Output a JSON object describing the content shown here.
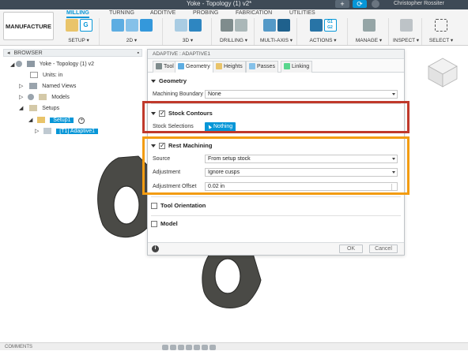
{
  "window": {
    "title": "Yoke - Topology (1) v2*",
    "user": "Christopher Rossiter"
  },
  "ribbon": {
    "workspace": "MANUFACTURE ▾",
    "tabs": [
      {
        "label": "MILLING",
        "active": true
      },
      {
        "label": "TURNING",
        "active": false
      },
      {
        "label": "ADDITIVE",
        "active": false
      },
      {
        "label": "PROBING",
        "active": false
      },
      {
        "label": "FABRICATION",
        "active": false
      },
      {
        "label": "UTILITIES",
        "active": false
      }
    ],
    "groups": [
      {
        "label": "SETUP ▾"
      },
      {
        "label": "2D ▾"
      },
      {
        "label": "3D ▾"
      },
      {
        "label": "DRILLING ▾"
      },
      {
        "label": "MULTI-AXIS ▾"
      },
      {
        "label": "ACTIONS ▾"
      },
      {
        "label": "MANAGE ▾"
      },
      {
        "label": "INSPECT ▾"
      },
      {
        "label": "SELECT ▾"
      }
    ]
  },
  "browser": {
    "header": "BROWSER",
    "items": [
      {
        "label": "Yoke - Topology (1) v2"
      },
      {
        "label": "Units: in"
      },
      {
        "label": "Named Views"
      },
      {
        "label": "Models"
      },
      {
        "label": "Setups"
      },
      {
        "label": "Setup1"
      },
      {
        "label": "[T1] Adaptive1"
      }
    ]
  },
  "dialog": {
    "title": "ADAPTIVE : ADAPTIVE1",
    "tabs": [
      {
        "label": "Tool"
      },
      {
        "label": "Geometry",
        "active": true
      },
      {
        "label": "Heights"
      },
      {
        "label": "Passes"
      },
      {
        "label": "Linking"
      }
    ],
    "geometry": {
      "header": "Geometry",
      "machining_boundary_label": "Machining Boundary",
      "machining_boundary_value": "None"
    },
    "stock_contours": {
      "header": "Stock Contours",
      "checked": true,
      "selections_label": "Stock Selections",
      "selections_button": "Nothing"
    },
    "rest_machining": {
      "header": "Rest Machining",
      "checked": true,
      "source_label": "Source",
      "source_value": "From setup stock",
      "adjustment_label": "Adjustment",
      "adjustment_value": "Ignore cusps",
      "offset_label": "Adjustment Offset",
      "offset_value": "0.02 in"
    },
    "tool_orientation": {
      "header": "Tool Orientation",
      "checked": false
    },
    "model": {
      "header": "Model",
      "checked": false
    },
    "footer": {
      "ok": "OK",
      "cancel": "Cancel"
    }
  },
  "bottombar": {
    "comments": "COMMENTS"
  },
  "colors": {
    "accent": "#0696d7",
    "highlight_red": "#c0392b",
    "highlight_orange": "#f39c12",
    "model_part": "#4a4a46"
  }
}
